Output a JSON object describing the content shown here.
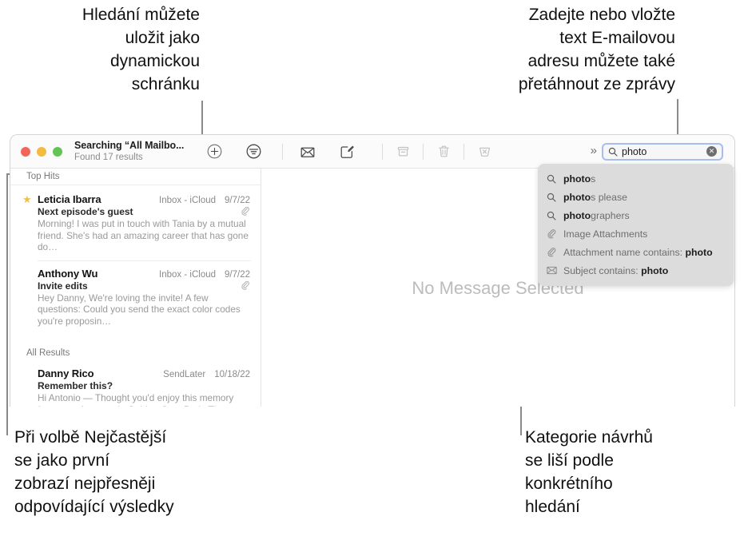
{
  "callouts": {
    "top_left": "Hledání můžete\nuložit jako\ndynamickou\nschránku",
    "top_right": "Zadejte nebo vložte\ntext E-mailovou\nadresu můžete také\npřetáhnout ze zprávy",
    "bottom_left": "Při volbě Nejčastější\nse jako první\nzobrazí nejpřesněji\nodpovídající výsledky",
    "bottom_right": "Kategorie návrhů\nse liší podle\nkonkrétního\nhledání"
  },
  "window": {
    "title": "Searching “All Mailbo...",
    "subtitle": "Found 17 results",
    "traffic_lights": [
      "close-red",
      "minimize-yellow",
      "zoom-green"
    ]
  },
  "toolbar": {
    "add_label": "+",
    "icons": [
      "add-smart-mailbox-icon",
      "filter-icon",
      "mail-icon",
      "compose-icon",
      "archive-icon",
      "trash-icon",
      "junk-icon"
    ],
    "overflow_label": "»"
  },
  "search": {
    "value": "photo",
    "placeholder": "Search",
    "clear_label": "✕",
    "accent_color": "#a7bdf0"
  },
  "suggestions": {
    "items": [
      {
        "icon": "search-icon",
        "bold": "photo",
        "rest": "s",
        "dim": false,
        "prefix": ""
      },
      {
        "icon": "search-icon",
        "bold": "photo",
        "rest": "s please",
        "dim": false,
        "prefix": ""
      },
      {
        "icon": "search-icon",
        "bold": "photo",
        "rest": "graphers",
        "dim": false,
        "prefix": ""
      },
      {
        "icon": "paperclip-icon",
        "bold": "",
        "rest": "",
        "dim": true,
        "prefix": "Image Attachments"
      },
      {
        "icon": "paperclip-icon",
        "bold": "photo",
        "rest": "",
        "dim": true,
        "prefix": "Attachment name contains: "
      },
      {
        "icon": "envelope-icon",
        "bold": "photo",
        "rest": "",
        "dim": true,
        "prefix": "Subject contains: "
      }
    ]
  },
  "message_list": {
    "sections": [
      {
        "header": "Top Hits",
        "messages": [
          {
            "starred": true,
            "sender": "Leticia Ibarra",
            "mailbox": "Inbox - iCloud",
            "date": "9/7/22",
            "subject": "Next episode's guest",
            "attachment": true,
            "preview": "Morning! I was put in touch with Tania by a mutual friend. She's had an amazing career that has gone do…"
          },
          {
            "starred": false,
            "sender": "Anthony Wu",
            "mailbox": "Inbox - iCloud",
            "date": "9/7/22",
            "subject": "Invite edits",
            "attachment": true,
            "preview": "Hey Danny, We're loving the invite! A few questions: Could you send the exact color codes you're proposin…"
          }
        ]
      },
      {
        "header": "All Results",
        "messages": [
          {
            "starred": false,
            "sender": "Danny Rico",
            "mailbox": "SendLater",
            "date": "10/18/22",
            "subject": "Remember this?",
            "attachment": false,
            "preview": "Hi Antonio — Thought you'd enjoy this memory from our afternoon in Golden Gate Park. The flowers were…"
          }
        ]
      }
    ]
  },
  "detail_pane": {
    "empty_state": "No Message Selected"
  }
}
